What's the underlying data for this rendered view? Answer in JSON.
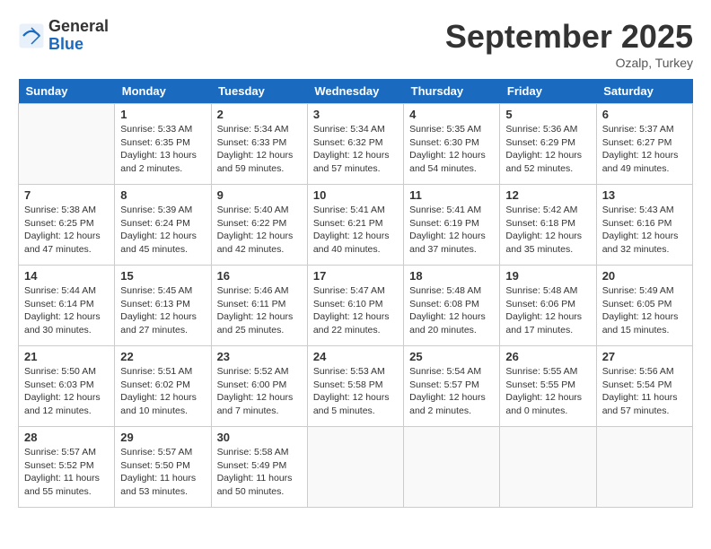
{
  "header": {
    "logo_general": "General",
    "logo_blue": "Blue",
    "month_title": "September 2025",
    "location": "Ozalp, Turkey"
  },
  "days_of_week": [
    "Sunday",
    "Monday",
    "Tuesday",
    "Wednesday",
    "Thursday",
    "Friday",
    "Saturday"
  ],
  "weeks": [
    [
      {
        "day": "",
        "info": ""
      },
      {
        "day": "1",
        "info": "Sunrise: 5:33 AM\nSunset: 6:35 PM\nDaylight: 13 hours\nand 2 minutes."
      },
      {
        "day": "2",
        "info": "Sunrise: 5:34 AM\nSunset: 6:33 PM\nDaylight: 12 hours\nand 59 minutes."
      },
      {
        "day": "3",
        "info": "Sunrise: 5:34 AM\nSunset: 6:32 PM\nDaylight: 12 hours\nand 57 minutes."
      },
      {
        "day": "4",
        "info": "Sunrise: 5:35 AM\nSunset: 6:30 PM\nDaylight: 12 hours\nand 54 minutes."
      },
      {
        "day": "5",
        "info": "Sunrise: 5:36 AM\nSunset: 6:29 PM\nDaylight: 12 hours\nand 52 minutes."
      },
      {
        "day": "6",
        "info": "Sunrise: 5:37 AM\nSunset: 6:27 PM\nDaylight: 12 hours\nand 49 minutes."
      }
    ],
    [
      {
        "day": "7",
        "info": "Sunrise: 5:38 AM\nSunset: 6:25 PM\nDaylight: 12 hours\nand 47 minutes."
      },
      {
        "day": "8",
        "info": "Sunrise: 5:39 AM\nSunset: 6:24 PM\nDaylight: 12 hours\nand 45 minutes."
      },
      {
        "day": "9",
        "info": "Sunrise: 5:40 AM\nSunset: 6:22 PM\nDaylight: 12 hours\nand 42 minutes."
      },
      {
        "day": "10",
        "info": "Sunrise: 5:41 AM\nSunset: 6:21 PM\nDaylight: 12 hours\nand 40 minutes."
      },
      {
        "day": "11",
        "info": "Sunrise: 5:41 AM\nSunset: 6:19 PM\nDaylight: 12 hours\nand 37 minutes."
      },
      {
        "day": "12",
        "info": "Sunrise: 5:42 AM\nSunset: 6:18 PM\nDaylight: 12 hours\nand 35 minutes."
      },
      {
        "day": "13",
        "info": "Sunrise: 5:43 AM\nSunset: 6:16 PM\nDaylight: 12 hours\nand 32 minutes."
      }
    ],
    [
      {
        "day": "14",
        "info": "Sunrise: 5:44 AM\nSunset: 6:14 PM\nDaylight: 12 hours\nand 30 minutes."
      },
      {
        "day": "15",
        "info": "Sunrise: 5:45 AM\nSunset: 6:13 PM\nDaylight: 12 hours\nand 27 minutes."
      },
      {
        "day": "16",
        "info": "Sunrise: 5:46 AM\nSunset: 6:11 PM\nDaylight: 12 hours\nand 25 minutes."
      },
      {
        "day": "17",
        "info": "Sunrise: 5:47 AM\nSunset: 6:10 PM\nDaylight: 12 hours\nand 22 minutes."
      },
      {
        "day": "18",
        "info": "Sunrise: 5:48 AM\nSunset: 6:08 PM\nDaylight: 12 hours\nand 20 minutes."
      },
      {
        "day": "19",
        "info": "Sunrise: 5:48 AM\nSunset: 6:06 PM\nDaylight: 12 hours\nand 17 minutes."
      },
      {
        "day": "20",
        "info": "Sunrise: 5:49 AM\nSunset: 6:05 PM\nDaylight: 12 hours\nand 15 minutes."
      }
    ],
    [
      {
        "day": "21",
        "info": "Sunrise: 5:50 AM\nSunset: 6:03 PM\nDaylight: 12 hours\nand 12 minutes."
      },
      {
        "day": "22",
        "info": "Sunrise: 5:51 AM\nSunset: 6:02 PM\nDaylight: 12 hours\nand 10 minutes."
      },
      {
        "day": "23",
        "info": "Sunrise: 5:52 AM\nSunset: 6:00 PM\nDaylight: 12 hours\nand 7 minutes."
      },
      {
        "day": "24",
        "info": "Sunrise: 5:53 AM\nSunset: 5:58 PM\nDaylight: 12 hours\nand 5 minutes."
      },
      {
        "day": "25",
        "info": "Sunrise: 5:54 AM\nSunset: 5:57 PM\nDaylight: 12 hours\nand 2 minutes."
      },
      {
        "day": "26",
        "info": "Sunrise: 5:55 AM\nSunset: 5:55 PM\nDaylight: 12 hours\nand 0 minutes."
      },
      {
        "day": "27",
        "info": "Sunrise: 5:56 AM\nSunset: 5:54 PM\nDaylight: 11 hours\nand 57 minutes."
      }
    ],
    [
      {
        "day": "28",
        "info": "Sunrise: 5:57 AM\nSunset: 5:52 PM\nDaylight: 11 hours\nand 55 minutes."
      },
      {
        "day": "29",
        "info": "Sunrise: 5:57 AM\nSunset: 5:50 PM\nDaylight: 11 hours\nand 53 minutes."
      },
      {
        "day": "30",
        "info": "Sunrise: 5:58 AM\nSunset: 5:49 PM\nDaylight: 11 hours\nand 50 minutes."
      },
      {
        "day": "",
        "info": ""
      },
      {
        "day": "",
        "info": ""
      },
      {
        "day": "",
        "info": ""
      },
      {
        "day": "",
        "info": ""
      }
    ]
  ]
}
